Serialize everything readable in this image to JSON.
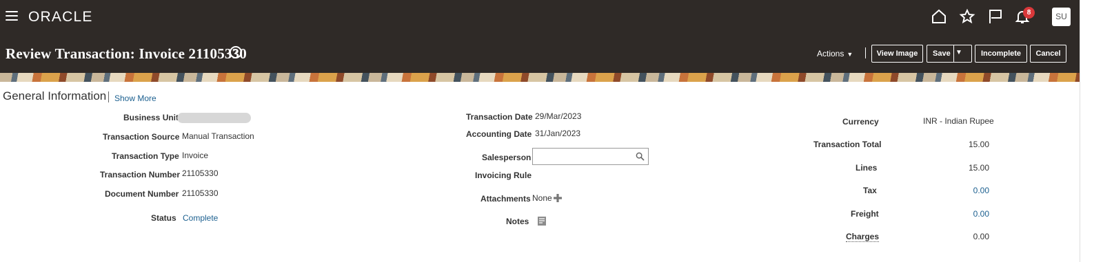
{
  "header": {
    "logo": "ORACLE",
    "notification_count": "8",
    "user_initials": "SU"
  },
  "titlebar": {
    "title": "Review Transaction: Invoice 21105330",
    "help": "?",
    "actions_label": "Actions",
    "buttons": {
      "view_image": "View Image",
      "save": "Save",
      "incomplete": "Incomplete",
      "cancel": "Cancel"
    }
  },
  "section": {
    "title": "General Information",
    "show_more": "Show More"
  },
  "left": {
    "business_unit_label": "Business Unit",
    "transaction_source_label": "Transaction Source",
    "transaction_source": "Manual Transaction",
    "transaction_type_label": "Transaction Type",
    "transaction_type": "Invoice",
    "transaction_number_label": "Transaction Number",
    "transaction_number": "21105330",
    "document_number_label": "Document Number",
    "document_number": "21105330",
    "status_label": "Status",
    "status": "Complete"
  },
  "middle": {
    "transaction_date_label": "Transaction Date",
    "transaction_date": "29/Mar/2023",
    "accounting_date_label": "Accounting Date",
    "accounting_date": "31/Jan/2023",
    "salesperson_label": "Salesperson",
    "salesperson_value": "",
    "invoicing_rule_label": "Invoicing Rule",
    "attachments_label": "Attachments",
    "attachments_value": "None",
    "notes_label": "Notes"
  },
  "right": {
    "currency_label": "Currency",
    "currency": "INR - Indian Rupee",
    "transaction_total_label": "Transaction Total",
    "transaction_total": "15.00",
    "lines_label": "Lines",
    "lines": "15.00",
    "tax_label": "Tax",
    "tax": "0.00",
    "freight_label": "Freight",
    "freight": "0.00",
    "charges_label": "Charges",
    "charges": "0.00"
  },
  "colors": {
    "header_bg": "#2f2a27",
    "link": "#1b5f8f",
    "badge": "#d9383a"
  },
  "icons": [
    "menu-icon",
    "home-icon",
    "star-icon",
    "flag-icon",
    "bell-icon",
    "help-icon",
    "search-icon",
    "plus-icon",
    "notes-icon"
  ]
}
